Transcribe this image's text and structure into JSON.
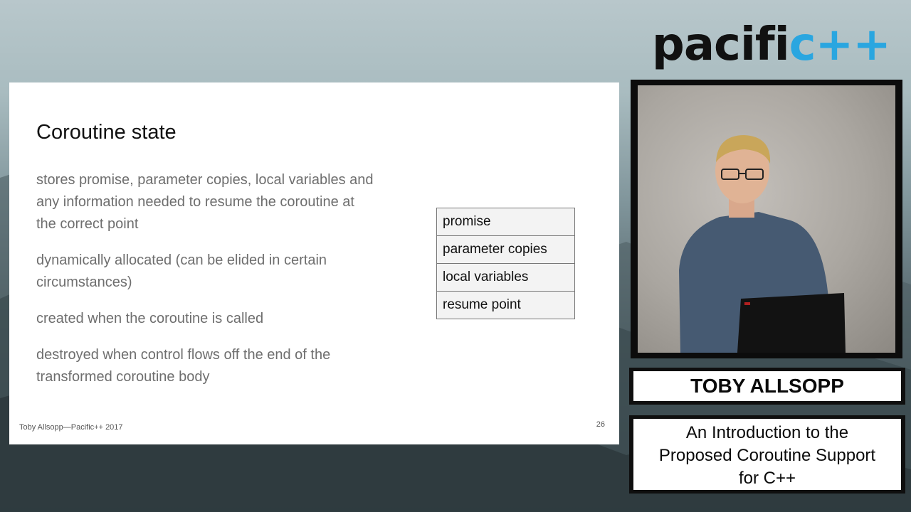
{
  "logo": {
    "main_text": "pacifi",
    "accent_text": "c++",
    "accent_color": "#2aa6e0"
  },
  "slide": {
    "title": "Coroutine state",
    "bullets": [
      "stores promise, parameter copies, local variables and any information needed to resume the coroutine at the correct point",
      "dynamically allocated (can be elided in certain circumstances)",
      "created when the coroutine is called",
      "destroyed when control flows off the end of the transformed coroutine body"
    ],
    "state_box": [
      "promise",
      "parameter copies",
      "local variables",
      "resume point"
    ],
    "footer": "Toby Allsopp—Pacific++ 2017",
    "page_number": "26"
  },
  "speaker": {
    "name": "TOBY ALLSOPP",
    "talk_title_lines": [
      "An Introduction to the",
      "Proposed Coroutine Support",
      "for C++"
    ]
  }
}
